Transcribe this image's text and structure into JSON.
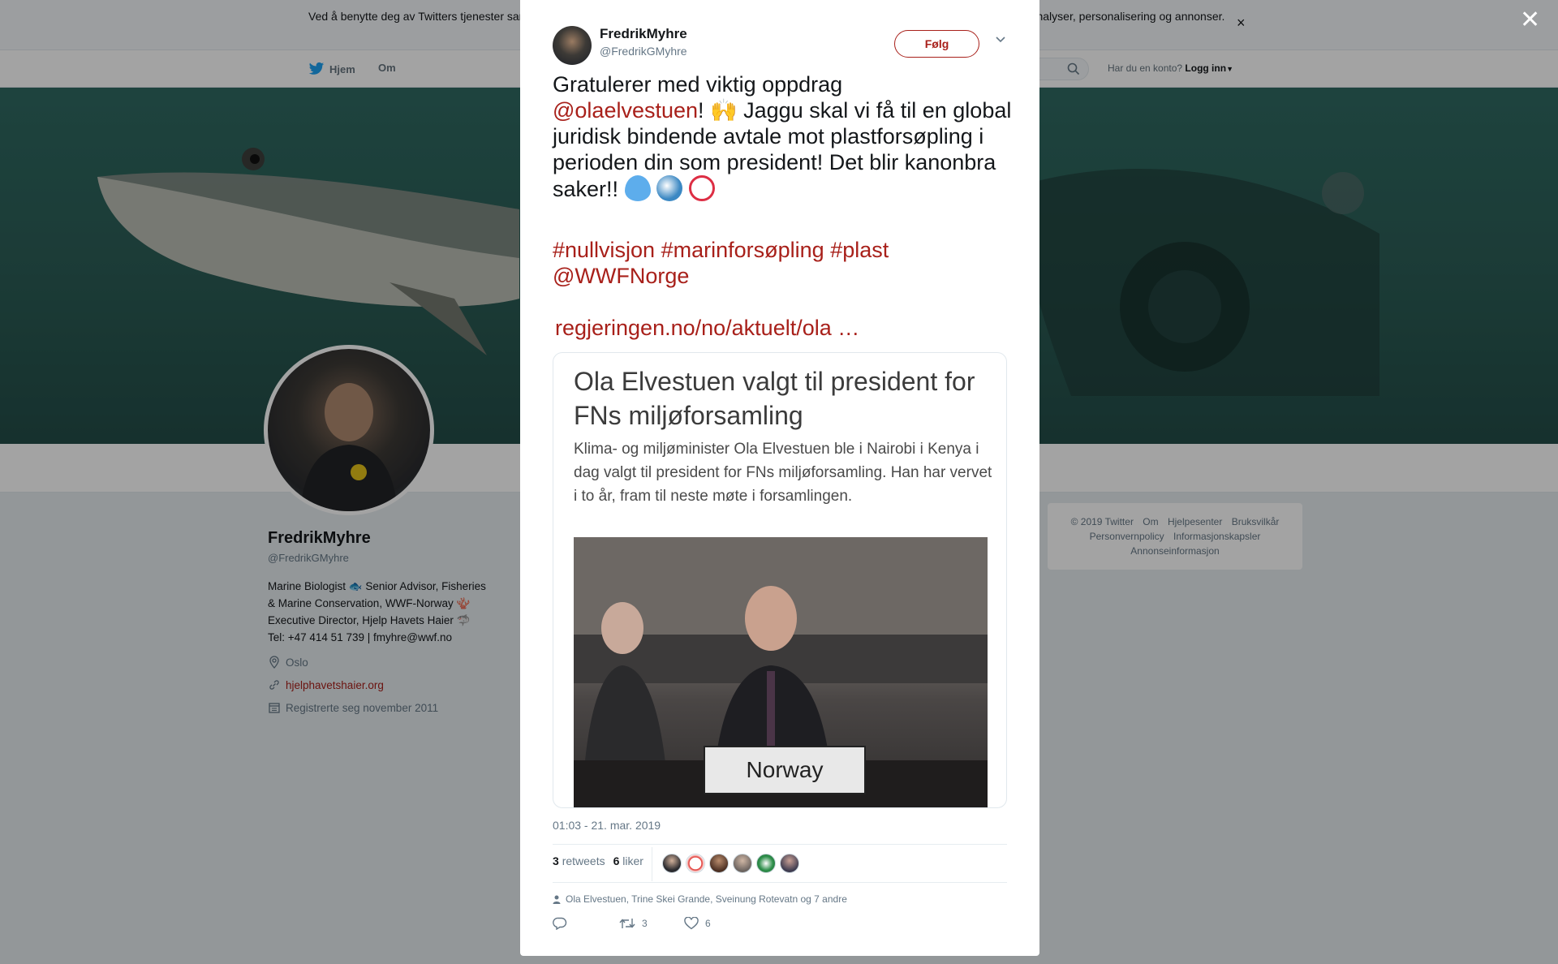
{
  "cookie_bar": {
    "text": "Ved å benytte deg av Twitters tjenester samtykker du til vår bruk av informasjonskapsler. Vi og våre partnere bruker informasjonskapsler til bl.a. analyser, personalisering og annonser."
  },
  "topnav": {
    "home": "Hjem",
    "about": "Om",
    "login_prompt": "Har du en konto?",
    "login": "Logg inn"
  },
  "profile": {
    "name": "FredrikMyhre",
    "handle": "@FredrikGMyhre",
    "bio_line1": "Marine Biologist 🐟 Senior Advisor, Fisheries",
    "bio_line2": "& Marine Conservation, WWF-Norway 🪸",
    "bio_line3": "Executive Director, Hjelp Havets Haier 🦈",
    "bio_line4": "Tel: +47 414 51 739 | fmyhre@wwf.no",
    "location": "Oslo",
    "website": "hjelphavetshaier.org",
    "joined": "Registrerte seg november 2011"
  },
  "footer": {
    "copyright": "© 2019 Twitter",
    "about": "Om",
    "help": "Hjelpesenter",
    "terms": "Bruksvilkår",
    "privacy": "Personvernpolicy",
    "cookies": "Informasjonskapsler",
    "ads": "Annonseinformasjon"
  },
  "tweet": {
    "author_name": "FredrikMyhre",
    "author_handle": "@FredrikGMyhre",
    "follow": "Følg",
    "text_part1": "Gratulerer med viktig oppdrag",
    "mention": "@olaelvestuen",
    "text_part2": "! 🙌 Jaggu skal vi få til en global juridisk bindende avtale mot plastforsøpling i perioden din som president! Det blir kanonbra saker!!",
    "hashtag1": "#nullvisjon",
    "hashtag2": "#marinforsøpling",
    "hashtag3": "#plast",
    "mention2": "@WWFNorge",
    "url": "regjeringen.no/no/aktuelt/ola  …",
    "card_title": "Ola Elvestuen valgt til president for FNs miljøforsamling",
    "card_description": "Klima- og miljøminister Ola Elvestuen ble i Nairobi i Kenya i dag valgt til president for FNs miljøforsamling. Han har vervet i to år, fram til neste møte i forsamlingen.",
    "card_sign": "Norway",
    "timestamp": "01:03 - 21. mar. 2019",
    "retweets_count": "3",
    "retweets_label": "retweets",
    "likes_count": "6",
    "likes_label": "liker",
    "liked_by": "Ola Elvestuen, Trine Skei Grande, Sveinung Rotevatn og 7 andre",
    "reply_count": "",
    "retweet_action_count": "3",
    "like_action_count": "6"
  },
  "colors": {
    "link": "#a8201a",
    "banner": "#2f6a62"
  }
}
